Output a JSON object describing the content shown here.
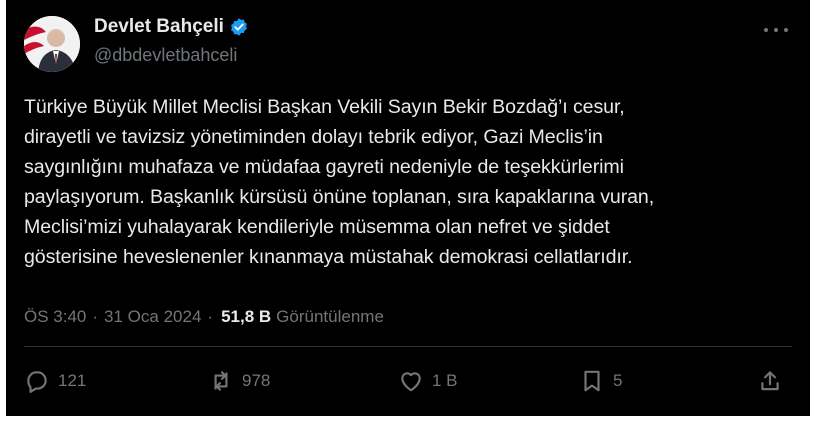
{
  "author": {
    "name": "Devlet Bahçeli",
    "handle": "@dbdevletbahceli"
  },
  "post": {
    "text": "Türkiye Büyük Millet Meclisi Başkan Vekili Sayın Bekir Bozdağ’ı cesur,\ndirayetli ve tavizsiz yönetiminden dolayı tebrik ediyor, Gazi Meclis’in\nsaygınlığını muhafaza ve müdafaa gayreti nedeniyle de teşekkürlerimi\npaylaşıyorum. Başkanlık kürsüsü önüne toplanan, sıra kapaklarına vuran,\nMeclisi’mizi yuhalayarak kendileriyle müsemma olan nefret ve şiddet\ngösterisine heveslenenler kınanmaya müstahak demokrasi cellatlarıdır.",
    "time": "ÖS 3:40",
    "separator": "·",
    "date": "31 Oca 2024",
    "views_count": "51,8 B",
    "views_label": "Görüntülenme"
  },
  "actions": {
    "replies": "121",
    "reposts": "978",
    "likes": "1 B",
    "bookmarks": "5"
  },
  "colors": {
    "background": "#000000",
    "text": "#e7e9ea",
    "muted": "#71767b",
    "verified": "#1d9bf0"
  },
  "icons": [
    "verified-badge-icon",
    "more-icon",
    "reply-icon",
    "repost-icon",
    "like-icon",
    "bookmark-icon",
    "share-icon"
  ]
}
